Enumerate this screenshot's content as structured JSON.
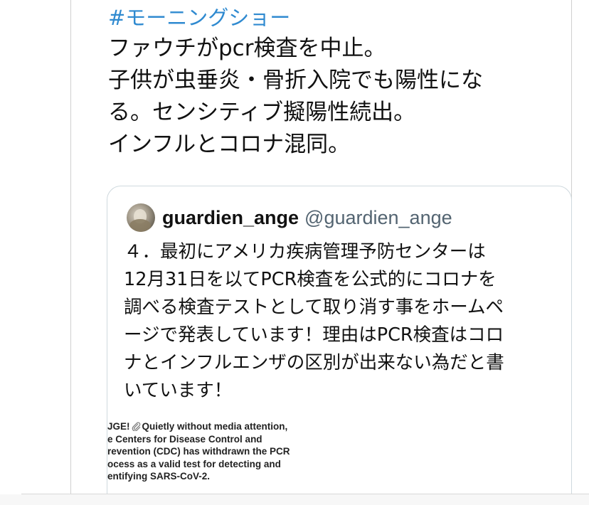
{
  "tweet": {
    "hashtag": "#モーニングショー",
    "lines": [
      "ファウチがpcr検査を中止。",
      "子供が虫垂炎・骨折入院でも陽性にな",
      "る。センシティブ擬陽性続出。",
      "インフルとコロナ混同。"
    ]
  },
  "quote": {
    "display_name": "guardien_ange",
    "handle": "@guardien_ange",
    "lines": [
      "４．最初にアメリカ疾病管理予防センターは",
      "12月31日を以てPCR検査を公式的にコロナを",
      "調べる検査テストとして取り消す事をホームペ",
      "ージで発表しています！理由はPCR検査はコロ",
      "ナとインフルエンザの区別が出来ない為だと書",
      "いています！"
    ],
    "embedded_image": {
      "line1_prefix": "JGE!",
      "line1_icon": "paperclip-icon",
      "line1_suffix": "Quietly without media attention,",
      "lines": [
        "e Centers for Disease Control and",
        "revention (CDC) has withdrawn the PCR",
        "ocess as a valid test for detecting and",
        "entifying SARS-CoV-2."
      ]
    }
  },
  "colors": {
    "hashtag": "#2f8ad0",
    "text": "#111111",
    "handle": "#536471",
    "card_border": "#cfd9de"
  }
}
